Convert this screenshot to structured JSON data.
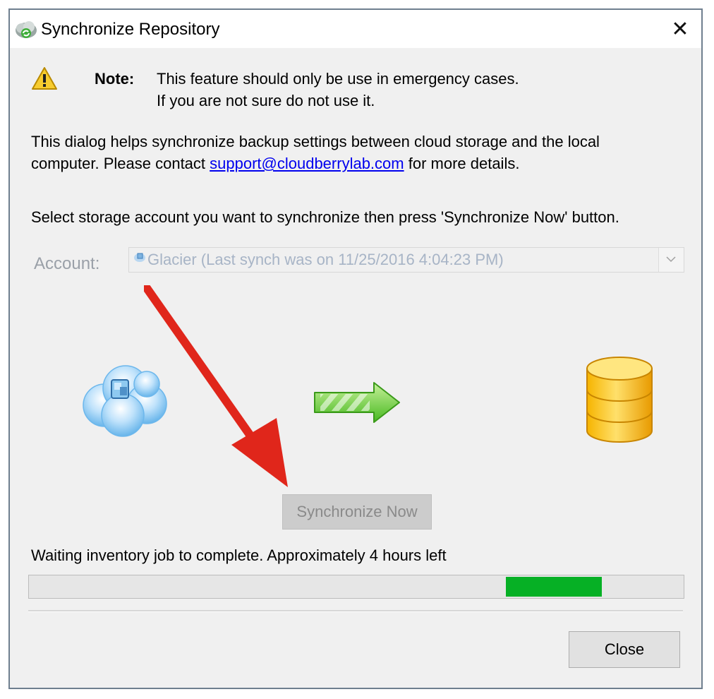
{
  "window": {
    "title": "Synchronize Repository",
    "close_glyph": "✕"
  },
  "note": {
    "label": "Note:",
    "line1": "This feature should only be use in emergency cases.",
    "line2": "If you are not sure do not use it."
  },
  "description": {
    "line1": "This dialog helps synchronize backup settings between cloud storage and the local",
    "line2_before": "computer. Please contact ",
    "support_link": "support@cloudberrylab.com",
    "line2_after": " for more details."
  },
  "instruction": "Select storage account you want to synchronize then press 'Synchronize Now' button.",
  "account": {
    "label": "Account:",
    "selected": "Glacier (Last synch was on 11/25/2016 4:04:23 PM)"
  },
  "buttons": {
    "synchronize_now": "Synchronize Now",
    "close": "Close"
  },
  "status": {
    "text": "Waiting inventory job to complete. Approximately 4 hours left"
  },
  "icons": {
    "app": "cloud-sync-icon",
    "warning": "warning-icon",
    "cloud": "glacier-cloud-icon",
    "transfer": "green-arrow-icon",
    "database": "database-icon",
    "annotation": "red-arrow-annotation"
  },
  "colors": {
    "progress_fill": "#06b025",
    "annotation_arrow": "#e0261b",
    "link": "#0000ee"
  }
}
